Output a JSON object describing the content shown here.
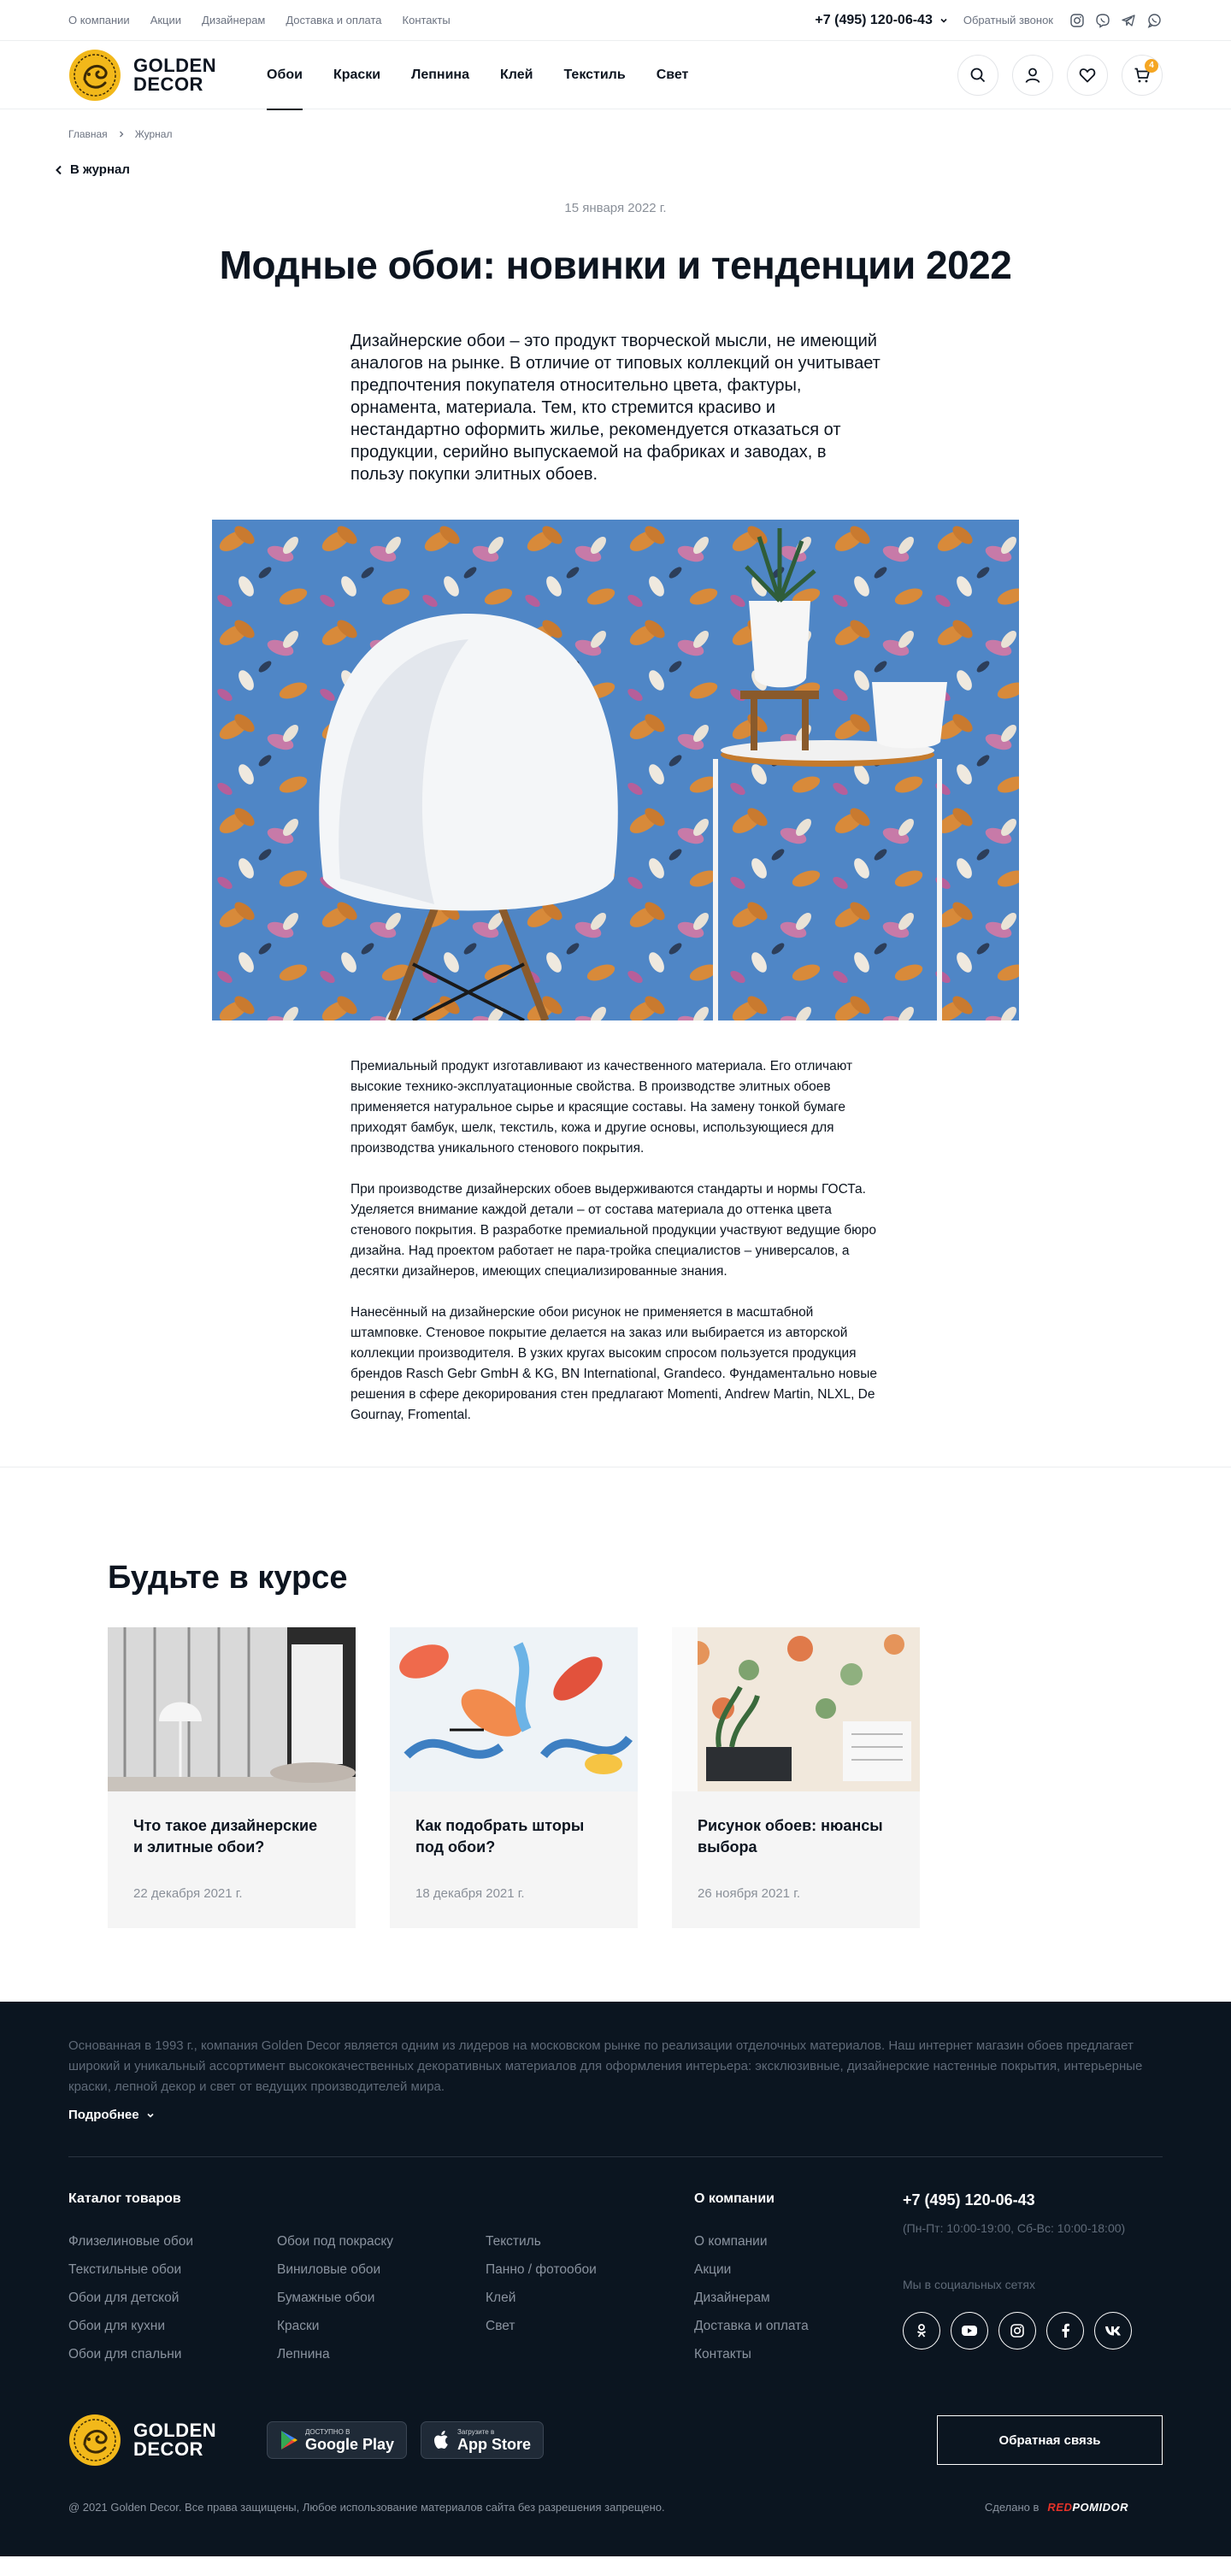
{
  "topbar": {
    "links": [
      "О компании",
      "Акции",
      "Дизайнерам",
      "Доставка и оплата",
      "Контакты"
    ],
    "phone": "+7 (495) 120-06-43",
    "callback": "Обратный звонок",
    "social_icons": [
      "instagram-icon",
      "viber-icon",
      "telegram-icon",
      "whatsapp-icon"
    ]
  },
  "header": {
    "logo_line1": "GOLDEN",
    "logo_line2": "DECOR",
    "nav": [
      "Обои",
      "Краски",
      "Лепнина",
      "Клей",
      "Текстиль",
      "Свет"
    ],
    "active_nav": "Обои",
    "cart_count": "4",
    "icons": [
      "search-icon",
      "user-icon",
      "heart-icon",
      "cart-icon"
    ]
  },
  "breadcrumb": {
    "home": "Главная",
    "current": "Журнал"
  },
  "back_link": "В журнал",
  "article": {
    "date": "15 января 2022 г.",
    "title": "Модные обои: новинки и тенденции 2022",
    "lead": "Дизайнерские обои – это продукт творческой мысли, не имеющий аналогов на рынке. В отличие от типовых коллекций он учитывает предпочтения покупателя относительно цвета, фактуры, орнамента, материала. Тем, кто стремится красиво и нестандартно оформить жилье, рекомендуется отказаться от продукции, серийно выпускаемой на фабриках и заводах, в пользу покупки элитных обоев.",
    "paragraphs": [
      "Премиальный продукт изготавливают из качественного материала. Его отличают высокие технико-эксплуатационные свойства. В производстве элитных обоев применяется натуральное сырье и красящие составы. На замену тонкой бумаге приходят бамбук, шелк, текстиль, кожа и другие основы, использующиеся для производства уникального стенового покрытия.",
      "При производстве дизайнерских обоев выдерживаются стандарты и нормы ГОСТа. Уделяется внимание каждой детали – от состава материала до оттенка цвета стенового покрытия. В разработке премиальной продукции участвуют ведущие бюро дизайна. Над проектом работает не пара-тройка специалистов – универсалов, а десятки дизайнеров, имеющих специализированные знания.",
      "Нанесённый на дизайнерские обои рисунок не применяется в масштабной штамповке. Стеновое покрытие делается на заказ или выбирается из авторской коллекции производителя. В узких кругах высоким спросом пользуется продукция брендов Rasch Gebr GmbH & KG, BN International, Grandeco. Фундаментально новые решения в сфере декорирования стен предлагают Momenti, Andrew Martin, NLXL, De Gournay, Fromental."
    ]
  },
  "related": {
    "title": "Будьте в курсе",
    "cards": [
      {
        "title": "Что такое дизайнерские и элитные обои?",
        "date": "22 декабря 2021 г."
      },
      {
        "title": "Как подобрать шторы под обои?",
        "date": "18 декабря 2021 г."
      },
      {
        "title": "Рисунок обоев: нюансы выбора",
        "date": "26 ноября 2021 г."
      }
    ]
  },
  "footer": {
    "about": "Основанная в 1993 г., компания Golden Decor является одним из лидеров на московском рынке по реализации отделочных материалов. Наш интернет магазин обоев предлагает широкий и уникальный ассортимент высококачественных декоративных материалов для оформления интерьера: эксклюзивные, дизайнерские настенные покрытия, интерьерные краски, лепной декор и свет от ведущих производителей мира.",
    "more": "Подробнее",
    "catalog_heading": "Каталог товаров",
    "catalog": [
      "Флизелиновые обои",
      "Обои под покраску",
      "Текстиль",
      "Текстильные обои",
      "Виниловые обои",
      "Панно / фотообои",
      "Обои для детской",
      "Бумажные обои",
      "Клей",
      "Обои для кухни",
      "Краски",
      "Свет",
      "Обои для спальни",
      "Лепнина"
    ],
    "company_heading": "О компании",
    "company": [
      "О компании",
      "Акции",
      "Дизайнерам",
      "Доставка и оплата",
      "Контакты"
    ],
    "phone": "+7 (495) 120-06-43",
    "hours": "(Пн-Пт: 10:00-19:00, Сб-Вс: 10:00-18:00)",
    "social_label": "Мы в социальных сетях",
    "social": [
      "ok-icon",
      "youtube-icon",
      "instagram-icon",
      "facebook-icon",
      "vk-icon"
    ],
    "google_play_small": "ДОСТУПНО В",
    "google_play": "Google Play",
    "app_store_small": "Загрузите в",
    "app_store": "App Store",
    "callback_button": "Обратная связь",
    "copyright": "@ 2021 Golden Decor. Все права защищены, Любое использование материалов сайта без разрешения запрещено.",
    "made_by": "Сделано в",
    "made_brand_red": "RED",
    "made_brand_white": "POMIDOR"
  }
}
